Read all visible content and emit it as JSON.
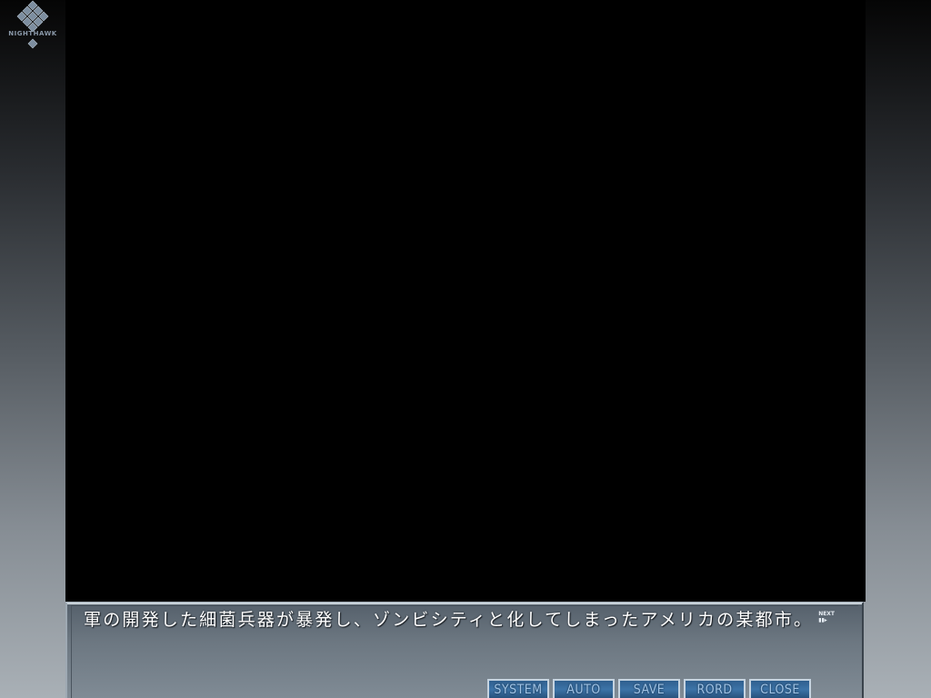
{
  "logo": {
    "text": "NIGHTHAWK"
  },
  "message": {
    "text": "軍の開発した細菌兵器が暴発し、ゾンビシティと化してしまったアメリカの某都市。",
    "next_marker_label": "NEXT",
    "next_marker_arrows": "▮▮▸"
  },
  "buttons": [
    {
      "label": "SYSTEM"
    },
    {
      "label": "AUTO"
    },
    {
      "label": "SAVE"
    },
    {
      "label": "RORD"
    },
    {
      "label": "CLOSE"
    }
  ],
  "colors": {
    "viewport": "#000000",
    "button_fill": "#3d74a8",
    "button_text": "#9fc3e6",
    "message_text": "#ffffff"
  }
}
